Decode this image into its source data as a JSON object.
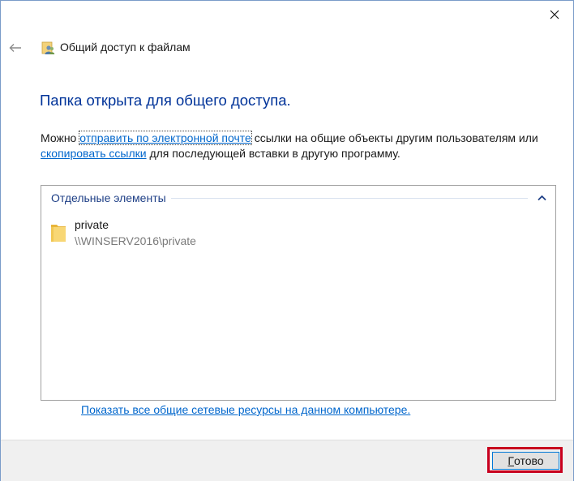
{
  "window": {
    "title": "Общий доступ к файлам",
    "title_icon": "share-users-icon",
    "back_icon": "back-arrow-icon",
    "close_icon": "close-icon"
  },
  "heading": "Папка открыта для общего доступа.",
  "description": {
    "part1": "Можно ",
    "link_email": "отправить по электронной почте",
    "part2": " ссылки на общие объекты другим пользователям или ",
    "link_copy": "скопировать ссылки",
    "part3": " для последующей вставки в другую программу."
  },
  "list": {
    "group_label": "Отдельные элементы",
    "collapse_icon": "chevron-up-icon",
    "items": [
      {
        "name": "private",
        "path": "\\\\WINSERV2016\\private",
        "icon": "folder-icon"
      }
    ]
  },
  "show_all_link": "Показать все общие сетевые ресурсы на данном компьютере.",
  "footer": {
    "done_label_first": "Г",
    "done_label_rest": "отово"
  },
  "colors": {
    "heading": "#003399",
    "link": "#0066cc",
    "highlight": "#c8001e",
    "button_border": "#0078d7"
  }
}
